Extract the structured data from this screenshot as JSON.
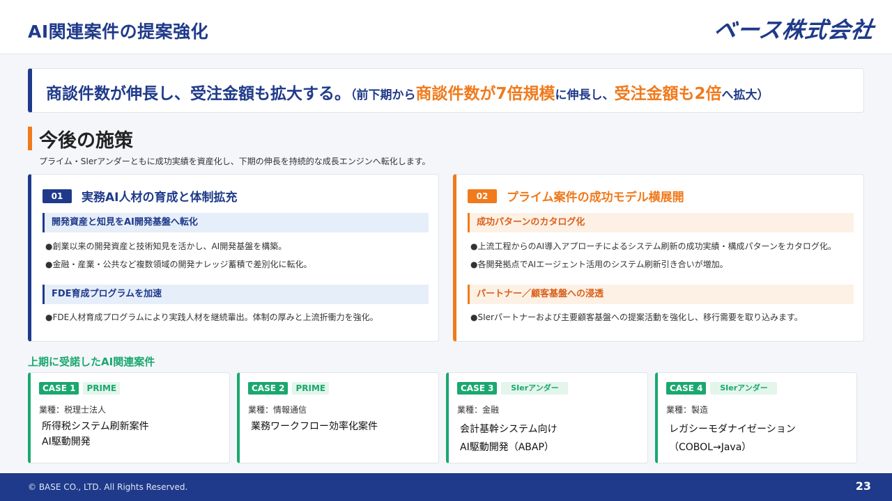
{
  "header": {
    "title": "AI関連案件の提案強化",
    "logo": "ベース株式会社"
  },
  "summary": {
    "main": "商談件数が伸長し、受注金額も拡大する。",
    "paren_open": "（前下期から",
    "hl1": "商談件数が7倍規模",
    "mid": "に伸長し、",
    "hl2": "受注金額も2倍",
    "end": "へ拡大）"
  },
  "section": {
    "title": "今後の施策",
    "subtitle": "プライム・SIerアンダーともに成功実績を資産化し、下期の伸長を持続的な成長エンジンへ転化します。"
  },
  "cards": [
    {
      "number": "01",
      "title": "実務AI人材の育成と体制拡充",
      "groups": [
        {
          "heading": "開発資産と知見をAI開発基盤へ転化",
          "bullets": [
            "●創業以来の開発資産と技術知見を活かし、AI開発基盤を構築。",
            "●金融・産業・公共など複数領域の開発ナレッジ蓄積で差別化に転化。"
          ]
        },
        {
          "heading": "FDE育成プログラムを加速",
          "bullets": [
            "●FDE人材育成プログラムにより実践人材を継続輩出。体制の厚みと上流折衝力を強化。"
          ]
        }
      ]
    },
    {
      "number": "02",
      "title": "プライム案件の成功モデル横展開",
      "groups": [
        {
          "heading": "成功パターンのカタログ化",
          "bullets": [
            "●上流工程からのAI導入アプローチによるシステム刷新の成功実績・構成パターンをカタログ化。",
            "●各開発拠点でAIエージェント活用のシステム刷新引き合いが増加。"
          ]
        },
        {
          "heading": "パートナー／顧客基盤への浸透",
          "bullets": [
            "●SIerパートナーおよび主要顧客基盤への提案活動を強化し、移行需要を取り込みます。"
          ]
        }
      ]
    }
  ],
  "cases_label": "上期に受諾したAI関連案件",
  "cases": [
    {
      "no": "CASE 1",
      "tag": "PRIME",
      "industry": "業種：税理士法人",
      "name1": "所得税システム刷新案件",
      "name2": "AI駆動開発"
    },
    {
      "no": "CASE 2",
      "tag": "PRIME",
      "industry": "業種：情報通信",
      "name1": "業務ワークフロー効率化案件",
      "name2": ""
    },
    {
      "no": "CASE 3",
      "tag": "SIerアンダー",
      "industry": "業種：金融",
      "name1": "会計基幹システム向け",
      "name2": "AI駆動開発（ABAP）"
    },
    {
      "no": "CASE 4",
      "tag": "SIerアンダー",
      "industry": "業種：製造",
      "name1": "レガシーモダナイゼーション",
      "name2": "（COBOL→Java）"
    }
  ],
  "footer": {
    "copyright": "© BASE CO., LTD. All Rights Reserved.",
    "page": "23"
  },
  "colors": {
    "navy": "#1f3a8a",
    "orange": "#f07a1c",
    "green": "#1aa86e"
  }
}
